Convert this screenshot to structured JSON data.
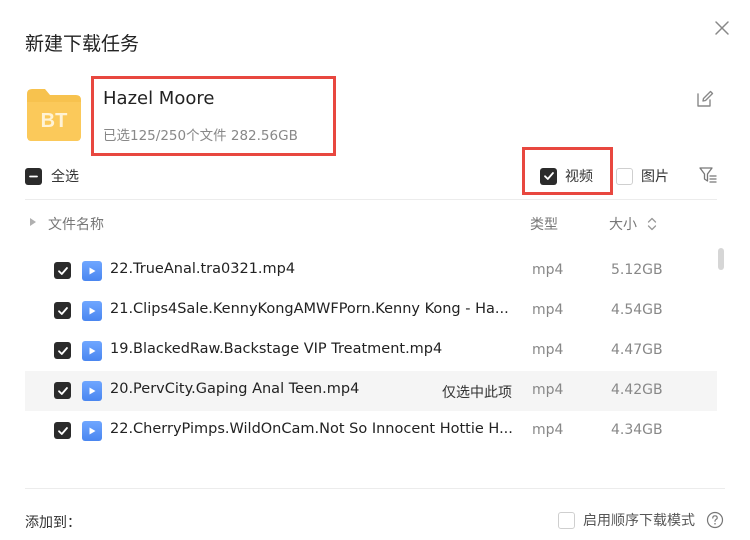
{
  "dialog": {
    "title": "新建下载任务"
  },
  "task": {
    "folder_label": "BT",
    "name": "Hazel Moore",
    "info": "已选125/250个文件 282.56GB"
  },
  "toolbar": {
    "select_all_label": "全选",
    "filter_video_label": "视频",
    "filter_image_label": "图片"
  },
  "columns": {
    "name": "文件名称",
    "type": "类型",
    "size": "大小"
  },
  "files": [
    {
      "name": "22.TrueAnal.tra0321.mp4",
      "type": "mp4",
      "size": "5.12GB",
      "checked": true
    },
    {
      "name": "21.Clips4Sale.KennyKongAMWFPorn.Kenny Kong - Ha...",
      "type": "mp4",
      "size": "4.54GB",
      "checked": true
    },
    {
      "name": "19.BlackedRaw.Backstage VIP Treatment.mp4",
      "type": "mp4",
      "size": "4.47GB",
      "checked": true
    },
    {
      "name": "20.PervCity.Gaping Anal Teen.mp4",
      "type": "mp4",
      "size": "4.42GB",
      "checked": true,
      "action": "仅选中此项"
    },
    {
      "name": "22.CherryPimps.WildOnCam.Not So Innocent Hottie H...",
      "type": "mp4",
      "size": "4.34GB",
      "checked": true
    }
  ],
  "footer": {
    "add_to_label": "添加到：",
    "sequential_label": "启用顺序下载模式"
  },
  "colors": {
    "folder": "#f7c24e",
    "checkbox": "#2b2b2b",
    "file_icon": "#5b93f5",
    "highlight": "#e8473f"
  }
}
